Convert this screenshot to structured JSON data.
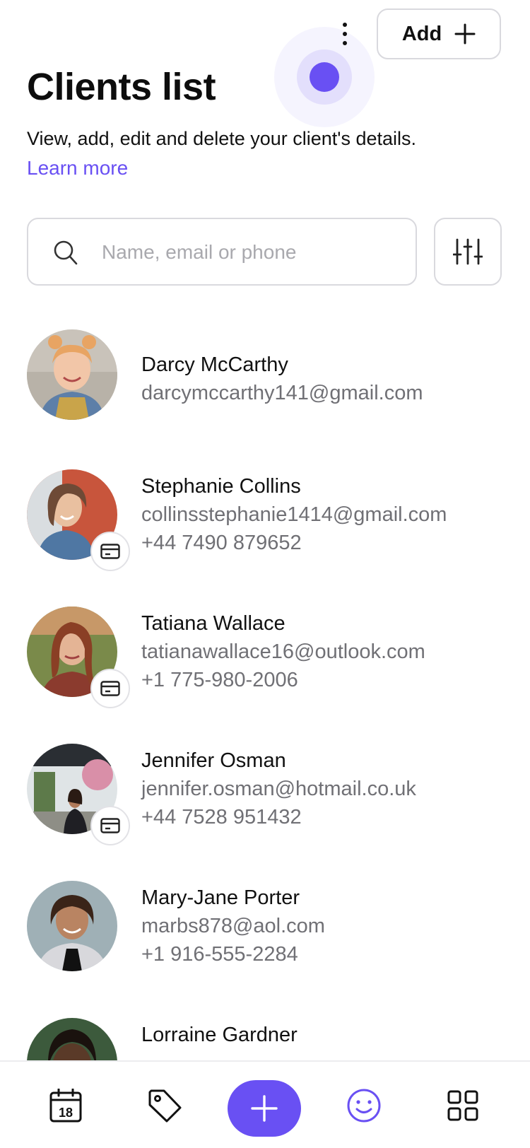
{
  "header": {
    "add_label": "Add",
    "title": "Clients list",
    "subtitle": "View, add, edit and delete your client's details.",
    "learn_more": "Learn more"
  },
  "search": {
    "placeholder": "Name, email or phone",
    "value": ""
  },
  "clients": [
    {
      "name": "Darcy McCarthy",
      "email": "darcymccarthy141@gmail.com",
      "phone": "",
      "has_card": false
    },
    {
      "name": "Stephanie Collins",
      "email": "collinsstephanie1414@gmail.com",
      "phone": "+44 7490 879652",
      "has_card": true
    },
    {
      "name": "Tatiana Wallace",
      "email": "tatianawallace16@outlook.com",
      "phone": "+1 775-980-2006",
      "has_card": true
    },
    {
      "name": "Jennifer Osman",
      "email": "jennifer.osman@hotmail.co.uk",
      "phone": "+44 7528 951432",
      "has_card": true
    },
    {
      "name": "Mary-Jane Porter",
      "email": "marbs878@aol.com",
      "phone": "+1 916-555-2284",
      "has_card": false
    },
    {
      "name": "Lorraine Gardner",
      "email": "",
      "phone": "",
      "has_card": false
    }
  ],
  "nav": {
    "calendar_day": "18",
    "items": [
      "calendar-icon",
      "tag-icon",
      "plus-icon",
      "smiley-icon",
      "grid-icon"
    ],
    "active": "smiley-icon"
  },
  "colors": {
    "accent": "#6950f3",
    "border": "#d9d9de",
    "muted_text": "#707075"
  }
}
